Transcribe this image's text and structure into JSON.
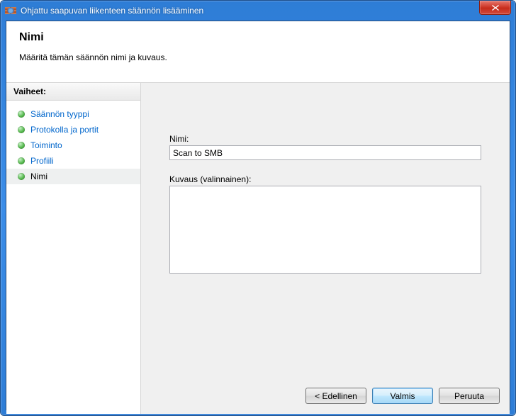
{
  "window": {
    "title": "Ohjattu saapuvan liikenteen säännön lisääminen"
  },
  "header": {
    "title": "Nimi",
    "subtitle": "Määritä tämän säännön nimi ja kuvaus."
  },
  "sidebar": {
    "heading": "Vaiheet:",
    "items": [
      {
        "label": "Säännön tyyppi",
        "current": false
      },
      {
        "label": "Protokolla ja portit",
        "current": false
      },
      {
        "label": "Toiminto",
        "current": false
      },
      {
        "label": "Profiili",
        "current": false
      },
      {
        "label": "Nimi",
        "current": true
      }
    ]
  },
  "form": {
    "name_label": "Nimi:",
    "name_value": "Scan to SMB",
    "desc_label": "Kuvaus (valinnainen):",
    "desc_value": ""
  },
  "buttons": {
    "back": "< Edellinen",
    "finish": "Valmis",
    "cancel": "Peruuta"
  }
}
